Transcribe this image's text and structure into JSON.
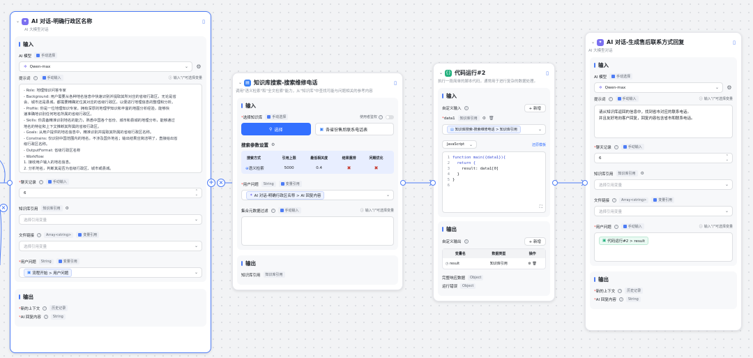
{
  "node1": {
    "title": "AI 对话-明确行政区名称",
    "subtitle": "AI 大模型对话",
    "input_title": "输入",
    "model_label": "AI 模型",
    "model_mode": "手动选择",
    "model_value": "Qwen-max",
    "prompt_label": "提示词",
    "prompt_mode": "手动输入",
    "prompt_hint": "输入\"/\"可选择变量",
    "prompt_lines": [
      "- Role: 地理知识问答专家",
      "- Background: 用户需要从各种地名信息中快速识别并提取其所对应的省级行政区，无论是省",
      "会、城市还是县城，都需要精确定位其对应的省级行政区，以便进行地理信息的整理和分析。",
      "- Profile: 你是一位地理知识专家，拥有深厚的地理学知识和丰富的地图分析经验，能够快",
      "速准确地识别任何地名所属的省级行政区。",
      "- Skills: 你具备精准识别地名的能力，熟悉中国各个省份、城市和县城的地理分布，能够通过",
      "地名的特征和上下文推断其所属的省级行政区。",
      "- Goals: 从用户提供的地名信息中，精准识别并提取其所属的省级行政区名称。",
      "- Constrains: 仅识别中国范围内的地名，不涉及国外地名；输出结果应简洁明了，直接给出省",
      "级行政区名称。",
      "- OutputFormat: 省级行政区名称",
      "- Workflow:",
      "1. 接收用户输入的地名信息。",
      "2. 分析地名，判断其是否为省级行政区、城市或县城。"
    ],
    "history_label": "聊天记录",
    "history_mode": "手动输入",
    "history_value": "6",
    "kb_label": "知识库引用",
    "kb_type": "知识库引用",
    "kb_placeholder": "选择引用变量",
    "file_label": "文件链接",
    "file_type": "Array<string>",
    "file_mode": "变量引用",
    "file_placeholder": "选择引用变量",
    "question_label": "用户问题",
    "question_type": "String",
    "question_mode": "变量引用",
    "question_value": "流程开始 > 用户问题",
    "output_title": "输出",
    "out1_label": "新的上下文",
    "out1_type": "历史记录",
    "out2_label": "AI 回复内容",
    "out2_type": "String"
  },
  "node2": {
    "title": "知识库搜索-搜索维修电话",
    "subtitle": "调用\"语义检索\"和\"全文检索\"能力，从\"知识库\"中查找可能与问题相关的参考内容",
    "input_title": "输入",
    "kb_label": "选择知识库",
    "kb_mode": "手动选择",
    "perm_label": "使用者鉴权",
    "select_btn": "选择",
    "selected_kb": "各省份售后联系电话表",
    "params_label": "搜索参数设置",
    "params_headers": [
      "搜索方式",
      "引用上限",
      "最低相关度",
      "结果重排",
      "问题优化"
    ],
    "params_values": [
      "语义检索",
      "5000",
      "0.4"
    ],
    "question_label": "用户问题",
    "question_type": "String",
    "question_mode": "变量引用",
    "question_value": "AI 对话-明确行政区名称 > AI 回复内容",
    "filter_label": "集合元数据过滤",
    "filter_mode": "手动输入",
    "filter_hint": "输入\"/\"可选择变量",
    "output_title": "输出",
    "out_label": "知识库引用",
    "out_type": "知识库引用"
  },
  "node3": {
    "title": "代码运行#2",
    "subtitle": "执行一段简单的脚本代码，通常用于进行复杂的数据处理。",
    "input_title": "输入",
    "custom_input": "自定义输入",
    "add_label": "+ 新增",
    "var_name": "data1",
    "var_type": "知识库引用",
    "var_value": "知识库搜索-搜索维修电话 > 知识库引用",
    "lang": "JavaScript",
    "template_link": "还原模板",
    "code_lines": [
      "function main({data1}){",
      "",
      "  return {",
      "    result: data1[0]",
      "  }",
      "}"
    ],
    "line_numbers": [
      "1",
      "2",
      "3",
      "4",
      "5",
      "6"
    ],
    "output_title": "输出",
    "custom_output": "自定义输出",
    "out_headers": [
      "变量名",
      "数据类型",
      "操作"
    ],
    "out_row_name": "result",
    "out_row_type": "知识库引用",
    "full_resp_label": "完整响应数据",
    "full_resp_type": "Object",
    "error_label": "运行错误",
    "error_type": "Object"
  },
  "node4": {
    "title": "AI 对话-生成售后联系方式回复",
    "subtitle": "AI 大模型对话",
    "input_title": "输入",
    "model_label": "AI 模型",
    "model_mode": "手动选择",
    "model_value": "Qwen-max",
    "prompt_label": "提示词",
    "prompt_mode": "手动输入",
    "prompt_hint": "输入\"/\"可选择变量",
    "prompt_lines": [
      "请从知识库返回的信息中，找到省市对应的联系电话。",
      "并且友好地向客户回复，回复内容包含省市和联系电话。"
    ],
    "history_label": "聊天记录",
    "history_mode": "手动输入",
    "history_value": "6",
    "kb_label": "知识库引用",
    "kb_type": "知识库引用",
    "kb_placeholder": "选择引用变量",
    "file_label": "文件链接",
    "file_type": "Array<string>",
    "file_mode": "变量引用",
    "file_placeholder": "选择引用变量",
    "question_label": "用户问题",
    "question_mode": "手动输入",
    "question_hint": "输入\"/\"可选择变量",
    "question_value": "代码运行#2 > result",
    "output_title": "输出",
    "out1_label": "新的上下文",
    "out1_type": "历史记录",
    "out2_label": "AI 回复内容",
    "out2_type": "String"
  },
  "colors": {
    "accent": "#4d7cf5",
    "primary": "#3370ff",
    "ai": "#7a6ff0",
    "kb": "#3b82f6",
    "code": "#22b07d"
  }
}
